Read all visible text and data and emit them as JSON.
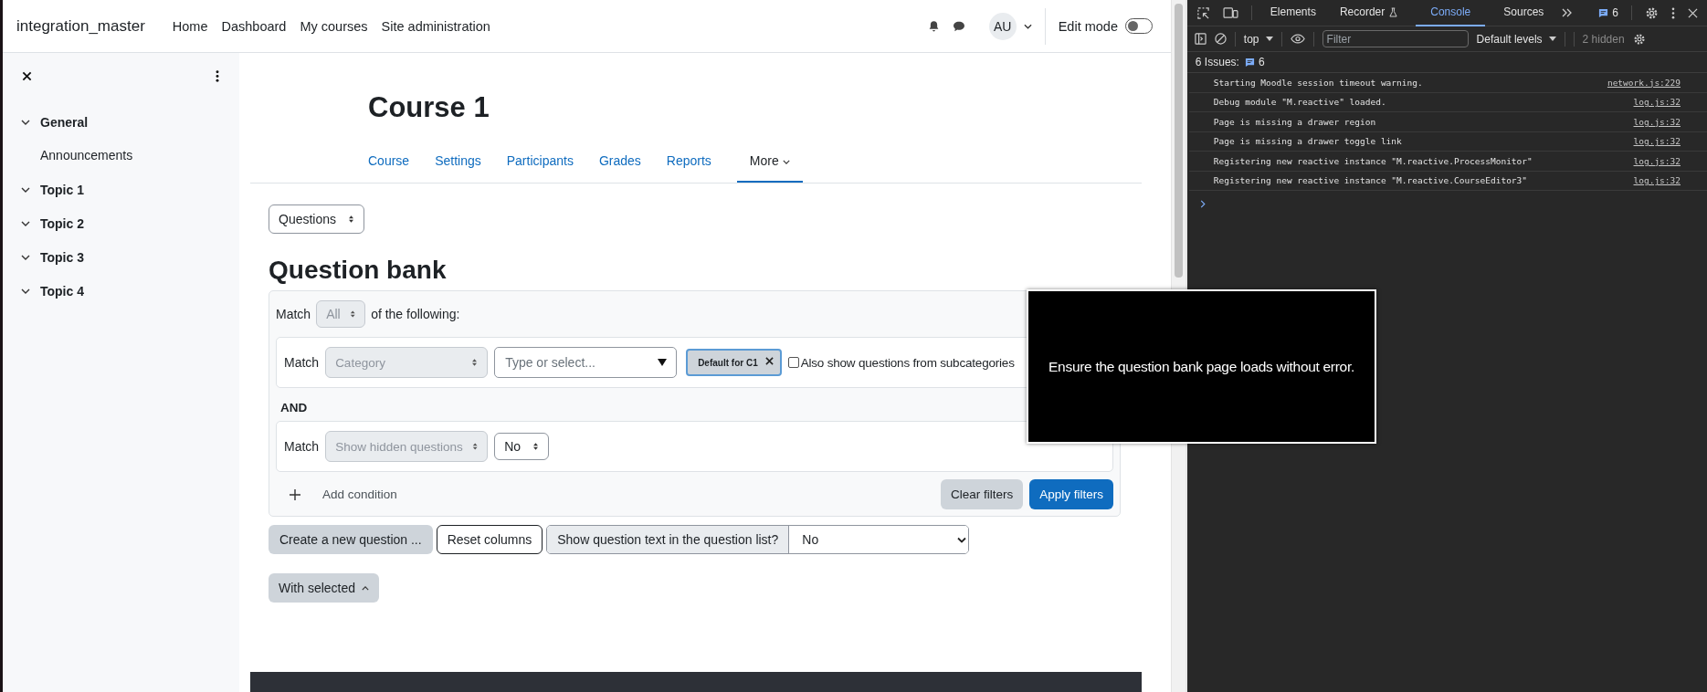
{
  "navbar": {
    "brand": "integration_master",
    "links": [
      "Home",
      "Dashboard",
      "My courses",
      "Site administration"
    ],
    "avatar": "AU",
    "edit_mode": {
      "label": "Edit mode",
      "on": false
    }
  },
  "sidebar": {
    "items": [
      {
        "label": "General",
        "expanded": true,
        "children": [
          {
            "label": "Announcements"
          }
        ]
      },
      {
        "label": "Topic 1",
        "expanded": true
      },
      {
        "label": "Topic 2",
        "expanded": true
      },
      {
        "label": "Topic 3",
        "expanded": true
      },
      {
        "label": "Topic 4",
        "expanded": true
      }
    ]
  },
  "course": {
    "title": "Course 1",
    "tabs": [
      {
        "label": "Course",
        "selected": false,
        "menu": false
      },
      {
        "label": "Settings",
        "selected": false,
        "menu": false
      },
      {
        "label": "Participants",
        "selected": false,
        "menu": false
      },
      {
        "label": "Grades",
        "selected": false,
        "menu": false
      },
      {
        "label": "Reports",
        "selected": false,
        "menu": false
      },
      {
        "label": "More",
        "selected": true,
        "menu": true
      }
    ]
  },
  "page_select": "Questions",
  "heading": "Question bank",
  "filters": {
    "match_label": "Match",
    "match_value": "All",
    "match_disabled": true,
    "match_suffix": "of the following:",
    "conditions": [
      {
        "match_label": "Match",
        "field": "Category",
        "field_disabled": true,
        "kind": "category",
        "placeholder": "Type or select...",
        "chip": "Default for C1",
        "checkbox": {
          "label": "Also show questions from subcategories",
          "checked": false
        }
      },
      {
        "match_label": "Match",
        "field": "Show hidden questions",
        "field_disabled": true,
        "kind": "choice",
        "value": "No"
      }
    ],
    "joiner": "AND",
    "add_condition": "Add condition",
    "clear": "Clear filters",
    "apply": "Apply filters"
  },
  "actions": {
    "create": "Create a new question ...",
    "reset": "Reset columns",
    "show_text_label": "Show question text in the question list?",
    "show_text_value": "No"
  },
  "with_selected": "With selected",
  "tooltip": "Ensure the question bank page loads without error.",
  "devtools": {
    "tabs": [
      {
        "label": "Elements",
        "selected": false
      },
      {
        "label": "Recorder",
        "selected": false
      },
      {
        "label": "Console",
        "selected": true
      },
      {
        "label": "Sources",
        "selected": false
      }
    ],
    "issues_badge": "6",
    "context": "top",
    "filter_placeholder": "Filter",
    "levels": "Default levels",
    "hidden": "2 hidden",
    "issues_label": "6 Issues:",
    "issues_count": "6",
    "logs": [
      {
        "message": "Starting Moodle session timeout warning.",
        "source": "network.js:229"
      },
      {
        "message": "Debug module \"M.reactive\" loaded.",
        "source": "log.js:32"
      },
      {
        "message": "Page is missing a drawer region",
        "source": "log.js:32"
      },
      {
        "message": "Page is missing a drawer toggle link",
        "source": "log.js:32"
      },
      {
        "message": "Registering new reactive instance \"M.reactive.ProcessMonitor\"",
        "source": "log.js:32"
      },
      {
        "message": "Registering new reactive instance \"M.reactive.CourseEditor3\"",
        "source": "log.js:32"
      }
    ]
  }
}
